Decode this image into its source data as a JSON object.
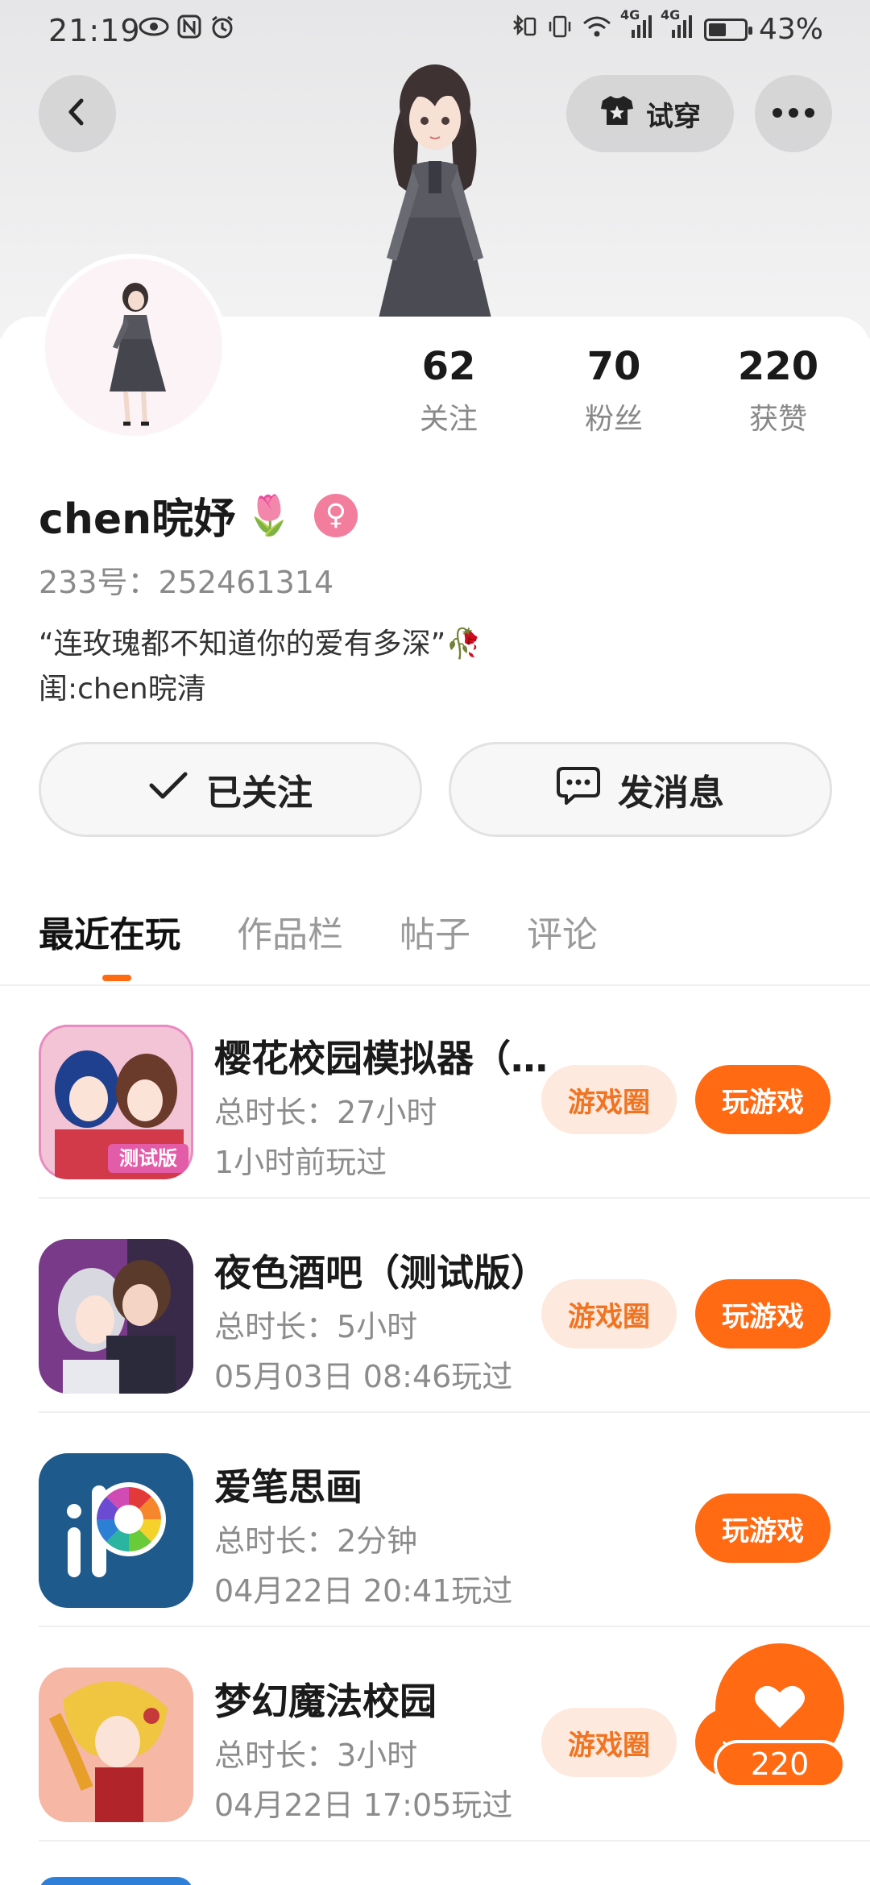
{
  "status_bar": {
    "time": "21:19",
    "network_4g_1": "4G",
    "network_4g_2": "4G",
    "battery_percent": "43%",
    "battery_level": 0.43
  },
  "header": {
    "try_on_label": "试穿"
  },
  "stats": [
    {
      "value": "62",
      "label": "关注"
    },
    {
      "value": "70",
      "label": "粉丝"
    },
    {
      "value": "220",
      "label": "获赞"
    }
  ],
  "profile": {
    "name": "chen晥妤",
    "name_emoji": "🌷",
    "gender_symbol": "♀",
    "uid": "233号：252461314",
    "bio_line1": "“连玫瑰都不知道你的爱有多深”🥀",
    "bio_line2": "闺:chen晥清"
  },
  "actions": {
    "follow_label": "已关注",
    "message_label": "发消息"
  },
  "tabs": [
    "最近在玩",
    "作品栏",
    "帖子",
    "评论"
  ],
  "games": [
    {
      "title": "樱花校园模拟器（测试版）",
      "duration": "总时长：27小时",
      "last_played": "1小时前玩过",
      "circle_label": "游戏圈",
      "play_label": "玩游戏",
      "has_circle": true
    },
    {
      "title": "夜色酒吧（测试版）",
      "duration": "总时长：5小时",
      "last_played": "05月03日 08:46玩过",
      "circle_label": "游戏圈",
      "play_label": "玩游戏",
      "has_circle": true
    },
    {
      "title": "爱笔思画",
      "duration": "总时长：2分钟",
      "last_played": "04月22日 20:41玩过",
      "circle_label": "",
      "play_label": "玩游戏",
      "has_circle": false
    },
    {
      "title": "梦幻魔法校园",
      "duration": "总时长：3小时",
      "last_played": "04月22日 17:05玩过",
      "circle_label": "游戏圈",
      "play_label": "玩游戏",
      "has_circle": true
    }
  ],
  "game_badge_text": "测试版",
  "like_fab": {
    "count": "220"
  },
  "colors": {
    "accent": "#ff6a13",
    "accent_light": "#fde9dd",
    "gender": "#f27d9c"
  }
}
